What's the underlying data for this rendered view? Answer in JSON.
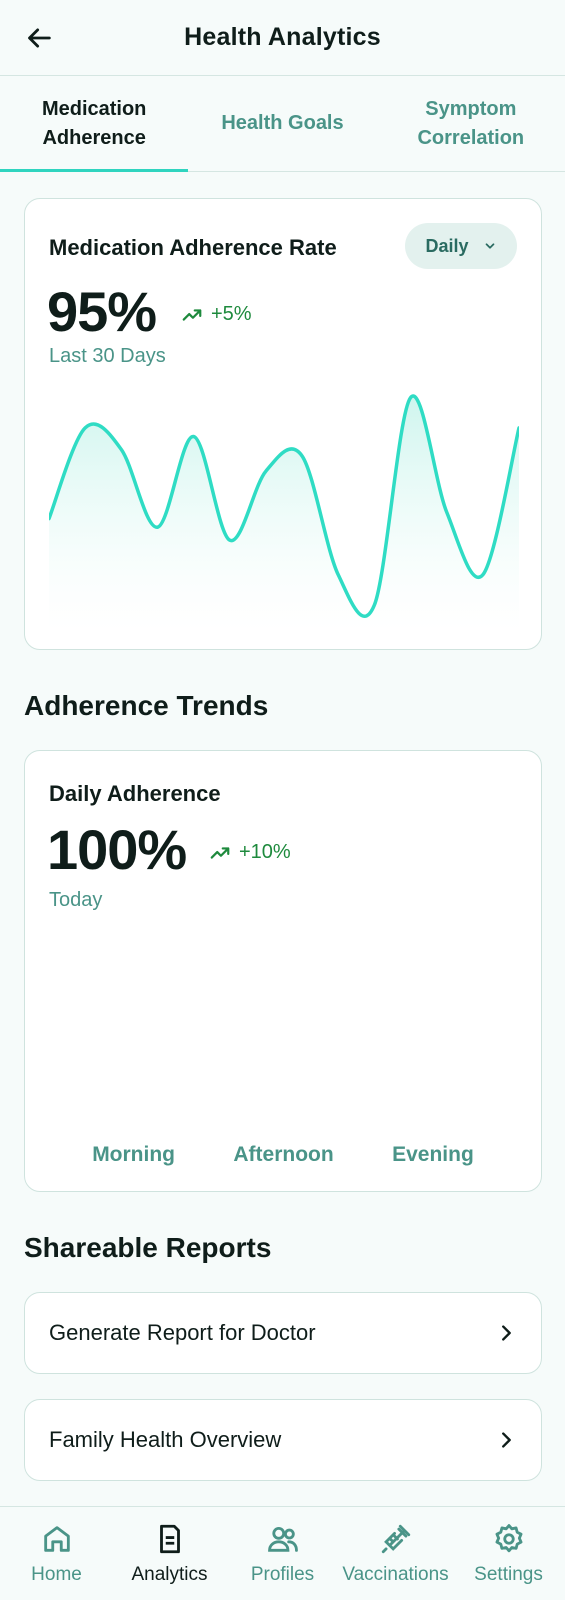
{
  "header": {
    "title": "Health Analytics",
    "back_icon": "arrow-left-icon"
  },
  "tabs": [
    {
      "label": "Medication\nAdherence",
      "active": true
    },
    {
      "label": "Health Goals",
      "active": false
    },
    {
      "label": "Symptom\nCorrelation",
      "active": false
    }
  ],
  "adherence_card": {
    "title": "Medication Adherence Rate",
    "period_select": "Daily",
    "value": "95%",
    "change": "+5%",
    "subtitle": "Last 30 Days"
  },
  "chart_data": {
    "type": "area",
    "values": [
      40,
      82,
      72,
      36,
      78,
      30,
      62,
      69,
      14,
      0,
      96,
      43,
      14,
      82
    ],
    "ylim": [
      0,
      100
    ],
    "grid": false,
    "colors": {
      "line": "#2fdcc4",
      "fill_top": "#c9f4ec",
      "fill_bottom": "#ffffff"
    }
  },
  "trends_section": {
    "title": "Adherence Trends",
    "card_title": "Daily Adherence",
    "value": "100%",
    "change": "+10%",
    "subtitle": "Today",
    "time_labels": [
      "Morning",
      "Afternoon",
      "Evening"
    ]
  },
  "reports_section": {
    "title": "Shareable Reports",
    "items": [
      "Generate Report for Doctor",
      "Family Health Overview"
    ]
  },
  "nav": [
    {
      "label": "Home",
      "icon": "home-icon",
      "active": false
    },
    {
      "label": "Analytics",
      "icon": "document-chart-icon",
      "active": true
    },
    {
      "label": "Profiles",
      "icon": "users-icon",
      "active": false
    },
    {
      "label": "Vaccinations",
      "icon": "syringe-icon",
      "active": false
    },
    {
      "label": "Settings",
      "icon": "gear-icon",
      "active": false
    }
  ],
  "colors": {
    "accent": "#2fd4bf",
    "positive": "#1e8a3d",
    "muted": "#4a9488"
  }
}
